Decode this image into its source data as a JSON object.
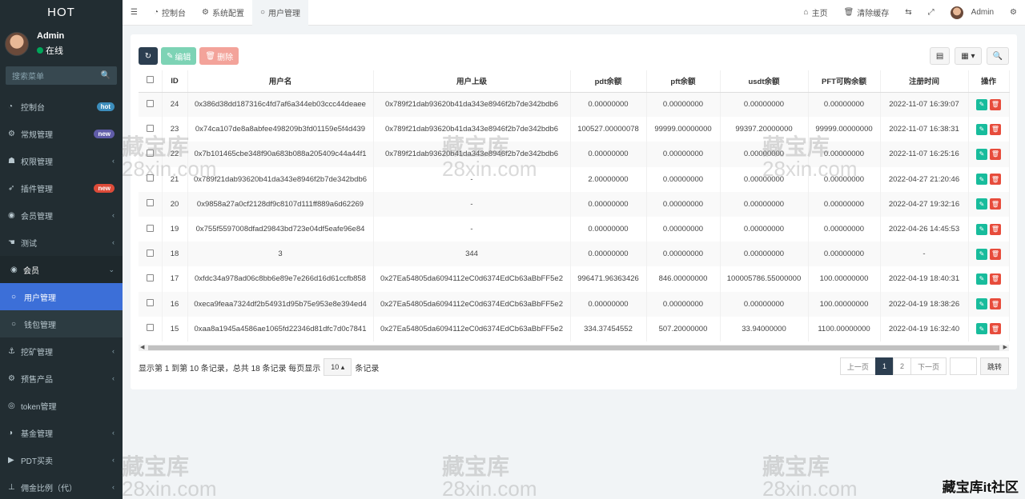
{
  "app": {
    "logo": "HOT"
  },
  "user": {
    "name": "Admin",
    "status": "在线"
  },
  "sidebar": {
    "search_placeholder": "搜索菜单",
    "items": [
      {
        "label": "控制台",
        "badge": "hot",
        "icon": "dashboard-icon"
      },
      {
        "label": "常规管理",
        "badge": "new",
        "icon": "cogs-icon"
      },
      {
        "label": "权限管理",
        "chevron": "‹",
        "icon": "group-icon"
      },
      {
        "label": "插件管理",
        "badge": "new",
        "icon": "rocket-icon"
      },
      {
        "label": "会员管理",
        "chevron": "‹",
        "icon": "user-circle-icon"
      },
      {
        "label": "测试",
        "chevron": "‹",
        "icon": "hand-icon"
      },
      {
        "label": "会员",
        "chevron": "⌄",
        "icon": "user-circle-icon"
      },
      {
        "label": "用户管理",
        "icon": "circle-icon"
      },
      {
        "label": "钱包管理",
        "icon": "circle-icon"
      },
      {
        "label": "挖矿管理",
        "chevron": "‹",
        "icon": "anchor-icon"
      },
      {
        "label": "预售产品",
        "chevron": "‹",
        "icon": "cogs-icon"
      },
      {
        "label": "token管理",
        "icon": "eye-icon"
      },
      {
        "label": "基金管理",
        "chevron": "‹",
        "icon": "adjust-icon"
      },
      {
        "label": "PDT买卖",
        "chevron": "‹",
        "icon": "play-circle-icon"
      },
      {
        "label": "佣金比例（代）",
        "chevron": "‹",
        "icon": "thumb-tack-icon"
      }
    ]
  },
  "header": {
    "tabs": [
      "控制台",
      "系统配置",
      "用户管理"
    ],
    "right": {
      "home": "主页",
      "clear_cache": "清除缓存",
      "admin": "Admin"
    }
  },
  "toolbar": {
    "edit": "编辑",
    "delete": "删除"
  },
  "table": {
    "columns": [
      "ID",
      "用户名",
      "用户上级",
      "pdt余额",
      "pft余额",
      "usdt余额",
      "PFT可购余额",
      "注册时间",
      "操作"
    ],
    "rows": [
      [
        "24",
        "0x386d38dd187316c4fd7af6a344eb03ccc44deaee",
        "0x789f21dab93620b41da343e8946f2b7de342bdb6",
        "0.00000000",
        "0.00000000",
        "0.00000000",
        "0.00000000",
        "2022-11-07 16:39:07"
      ],
      [
        "23",
        "0x74ca107de8a8abfee498209b3fd01159e5f4d439",
        "0x789f21dab93620b41da343e8946f2b7de342bdb6",
        "100527.00000078",
        "99999.00000000",
        "99397.20000000",
        "99999.00000000",
        "2022-11-07 16:38:31"
      ],
      [
        "22",
        "0x7b101465cbe348f90a683b088a205409c44a44f1",
        "0x789f21dab93620b41da343e8946f2b7de342bdb6",
        "0.00000000",
        "0.00000000",
        "0.00000000",
        "0.00000000",
        "2022-11-07 16:25:16"
      ],
      [
        "21",
        "0x789f21dab93620b41da343e8946f2b7de342bdb6",
        "-",
        "2.00000000",
        "0.00000000",
        "0.00000000",
        "0.00000000",
        "2022-04-27 21:20:46"
      ],
      [
        "20",
        "0x9858a27a0cf2128df9c8107d111ff889a6d62269",
        "-",
        "0.00000000",
        "0.00000000",
        "0.00000000",
        "0.00000000",
        "2022-04-27 19:32:16"
      ],
      [
        "19",
        "0x755f5597008dfad29843bd723e04df5eafe96e84",
        "-",
        "0.00000000",
        "0.00000000",
        "0.00000000",
        "0.00000000",
        "2022-04-26 14:45:53"
      ],
      [
        "18",
        "3",
        "344",
        "0.00000000",
        "0.00000000",
        "0.00000000",
        "0.00000000",
        "-"
      ],
      [
        "17",
        "0xfdc34a978ad06c8bb6e89e7e266d16d61ccfb858",
        "0x27Ea54805da6094112eC0d6374EdCb63aBbFF5e2",
        "996471.96363426",
        "846.00000000",
        "100005786.55000000",
        "100.00000000",
        "2022-04-19 18:40:31"
      ],
      [
        "16",
        "0xeca9feaa7324df2b54931d95b75e953e8e394ed4",
        "0x27Ea54805da6094112eC0d6374EdCb63aBbFF5e2",
        "0.00000000",
        "0.00000000",
        "0.00000000",
        "100.00000000",
        "2022-04-19 18:38:26"
      ],
      [
        "15",
        "0xaa8a1945a4586ae1065fd22346d81dfc7d0c7841",
        "0x27Ea54805da6094112eC0d6374EdCb63aBbFF5e2",
        "334.37454552",
        "507.20000000",
        "33.94000000",
        "1100.00000000",
        "2022-04-19 16:32:40"
      ]
    ]
  },
  "pagination": {
    "info_prefix": "显示第 1 到第 10 条记录，总共 18 条记录 每页显示",
    "page_size": "10",
    "info_suffix": "条记录",
    "prev": "上一页",
    "pages": [
      "1",
      "2"
    ],
    "next": "下一页",
    "go": "跳转"
  },
  "watermark": {
    "title": "藏宝库",
    "url": "28xin.com",
    "brand": "藏宝库it社区"
  }
}
